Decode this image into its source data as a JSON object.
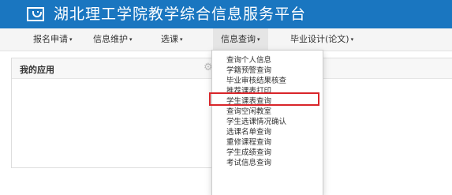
{
  "header": {
    "title": "湖北理工学院教学综合信息服务平台",
    "logo": "school-logo-icon"
  },
  "nav": {
    "items": [
      {
        "label": "报名申请",
        "caret": "▾"
      },
      {
        "label": "信息维护",
        "caret": "▾"
      },
      {
        "label": "选课",
        "caret": "▾"
      },
      {
        "label": "信息查询",
        "caret": "▾"
      },
      {
        "label": "毕业设计(论文)",
        "caret": "▾"
      }
    ],
    "active_index": 3
  },
  "panel": {
    "title": "我的应用",
    "settings_icon": "gear-icon"
  },
  "dropdown": {
    "items": [
      "查询个人信息",
      "学籍预警查询",
      "毕业审核结果核查",
      "推荐课表打印",
      "学生课表查询",
      "查询空闲教室",
      "学生选课情况确认",
      "选课名单查询",
      "重修课程查询",
      "学生成绩查询",
      "考试信息查询"
    ],
    "highlighted_index": 4,
    "highlight_color": "#d9252a"
  },
  "colors": {
    "header_bg": "#1a76c0",
    "nav_bg": "#f5f5f5"
  }
}
